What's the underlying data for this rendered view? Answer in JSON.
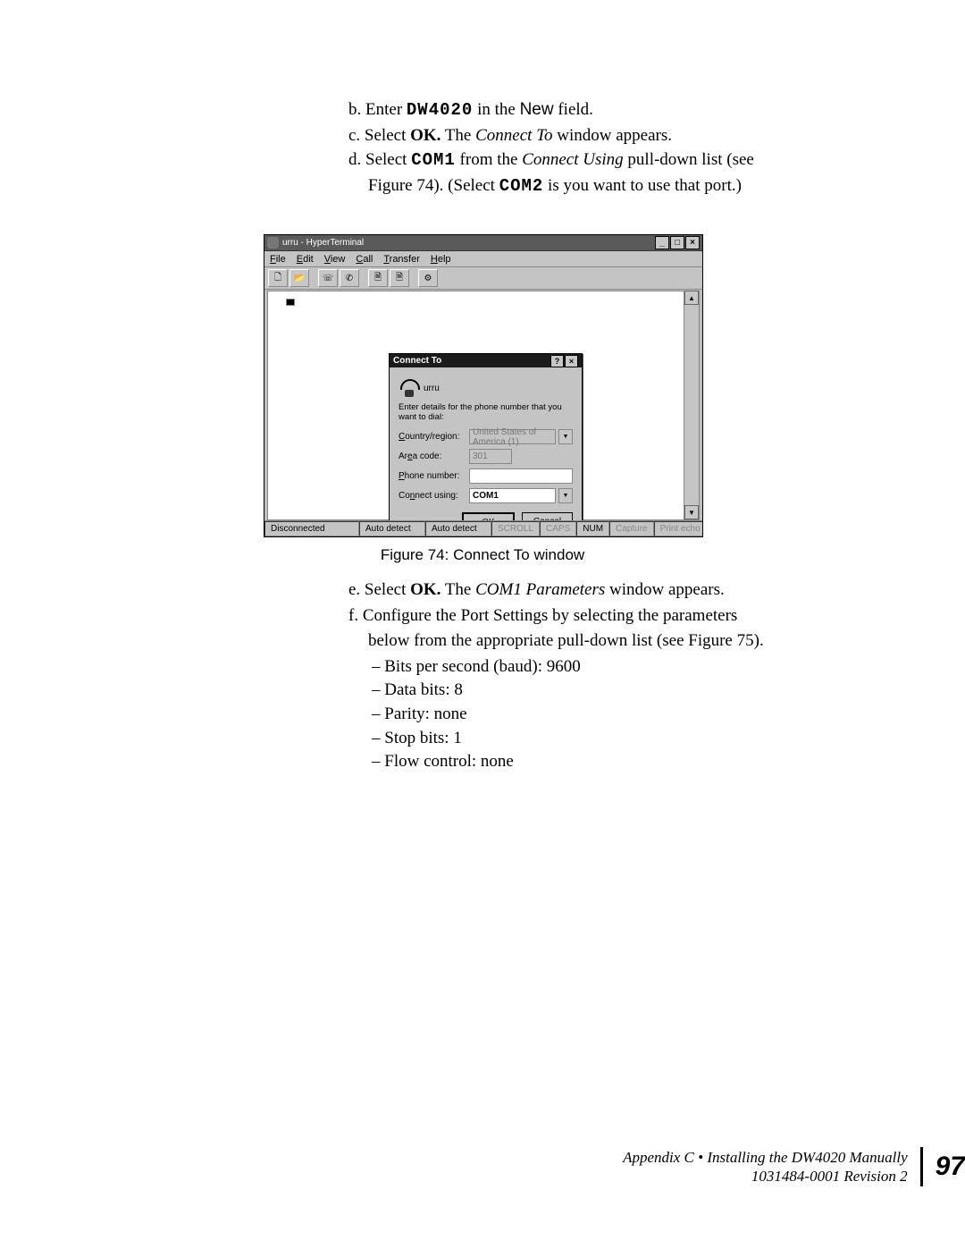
{
  "steps_top": {
    "b": {
      "prefix": "b. Enter ",
      "code": "DW4020",
      "mid": " in the ",
      "sans": "New",
      "suffix": " field."
    },
    "c": {
      "prefix": "c. Select ",
      "bold": "OK.",
      "mid": " The ",
      "ital": "Connect To",
      "suffix": " window appears."
    },
    "d": {
      "prefix": "d. Select ",
      "code": "COM1",
      "mid": " from the ",
      "ital": "Connect Using",
      "suffix": " pull-down list (see"
    },
    "d2": {
      "pre": "Figure 74). (Select ",
      "code": "COM2",
      "post": "  is you want to use that port.)"
    }
  },
  "figure": {
    "caption": "Figure 74:  Connect To window",
    "app_title": "urru - HyperTerminal",
    "menus": [
      "File",
      "Edit",
      "View",
      "Call",
      "Transfer",
      "Help"
    ],
    "status": {
      "disconnected": "Disconnected",
      "auto1": "Auto detect",
      "auto2": "Auto detect",
      "scroll": "SCROLL",
      "caps": "CAPS",
      "num": "NUM",
      "capture": "Capture",
      "echo": "Print echo"
    },
    "dialog": {
      "title": "Connect To",
      "conn_name": "urru",
      "instruction": "Enter details for the phone number that you want to dial:",
      "labels": {
        "country": "Country/region:",
        "area": "Area code:",
        "phone": "Phone number:",
        "using": "Connect using:"
      },
      "values": {
        "country": "United States of America (1)",
        "area": "301",
        "phone": "",
        "using": "COM1"
      },
      "ok": "OK",
      "cancel": "Cancel"
    }
  },
  "steps_mid": {
    "e": {
      "prefix": "e. Select ",
      "bold": "OK.",
      "mid": " The ",
      "ital": "COM1 Parameters",
      "suffix": " window appears."
    },
    "f1": "f. Configure the Port Settings by selecting the parameters",
    "f2": "below from the appropriate pull-down list (see Figure 75).",
    "bullets": [
      "– Bits per second (baud): 9600",
      "– Data bits: 8",
      "– Parity: none",
      "– Stop bits: 1",
      "– Flow control: none"
    ]
  },
  "footer": {
    "line1": "Appendix C • Installing the DW4020 Manually",
    "line2": "1031484-0001  Revision 2",
    "page": "97"
  }
}
